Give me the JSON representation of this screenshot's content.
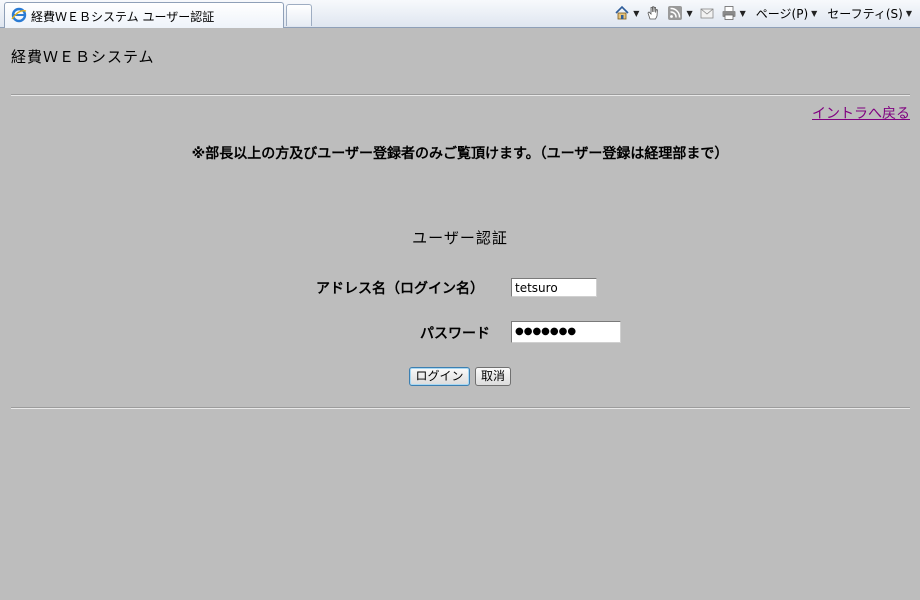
{
  "browser": {
    "tab_title": "経費ＷＥＢシステム ユーザー認証",
    "toolbar": {
      "page_menu": "ページ(P)",
      "safety_menu": "セーフティ(S)",
      "icons": [
        "home-icon",
        "hand-icon",
        "rss-feed-icon",
        "mail-icon",
        "print-icon"
      ]
    }
  },
  "page": {
    "app_title": "経費ＷＥＢシステム",
    "intranet_link": "イントラへ戻る",
    "notice": "※部長以上の方及びユーザー登録者のみご覧頂けます。（ユーザー登録は経理部まで）",
    "auth_heading": "ユーザー認証",
    "form": {
      "address_label": "アドレス名（ログイン名）",
      "address_value": "tetsuro",
      "password_label": "パスワード",
      "password_value": "●●●●●●●",
      "login_button": "ログイン",
      "cancel_button": "取消"
    }
  },
  "colors": {
    "page_background": "#bdbdbd",
    "visited_link": "#800080"
  }
}
